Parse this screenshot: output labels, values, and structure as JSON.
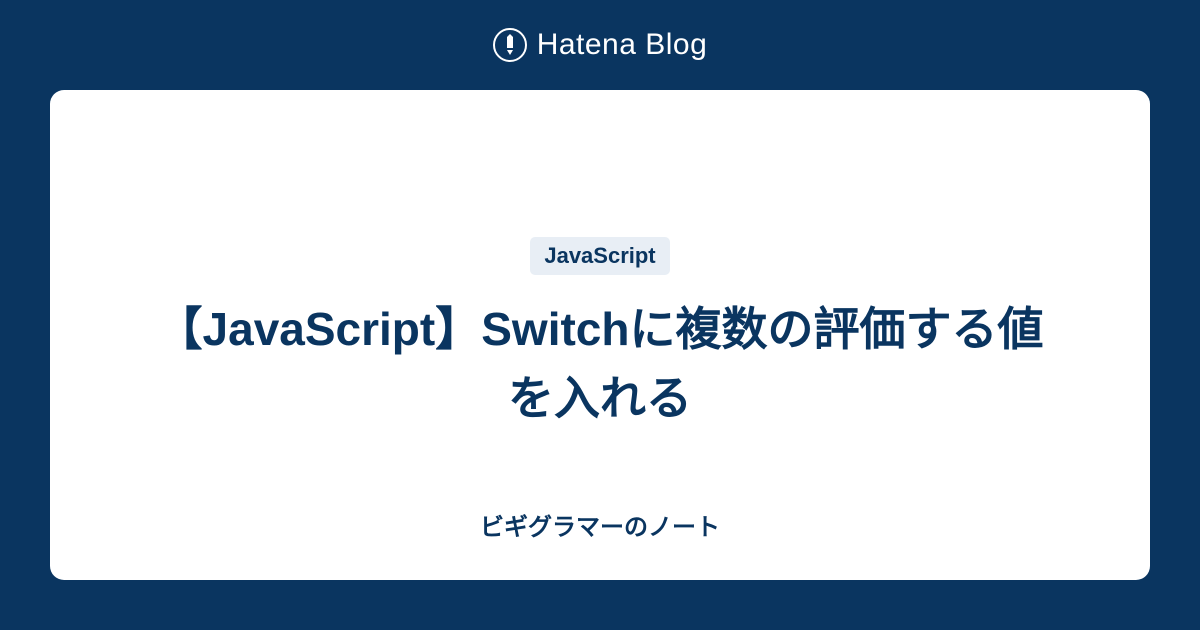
{
  "header": {
    "logo_text": "Hatena Blog"
  },
  "card": {
    "badge": "JavaScript",
    "title": "【JavaScript】Switchに複数の評価する値を入れる",
    "blog_name": "ビギグラマーのノート"
  },
  "colors": {
    "background": "#0a3560",
    "card_bg": "#ffffff",
    "text_primary": "#0a3560",
    "badge_bg": "#e8eef5"
  }
}
